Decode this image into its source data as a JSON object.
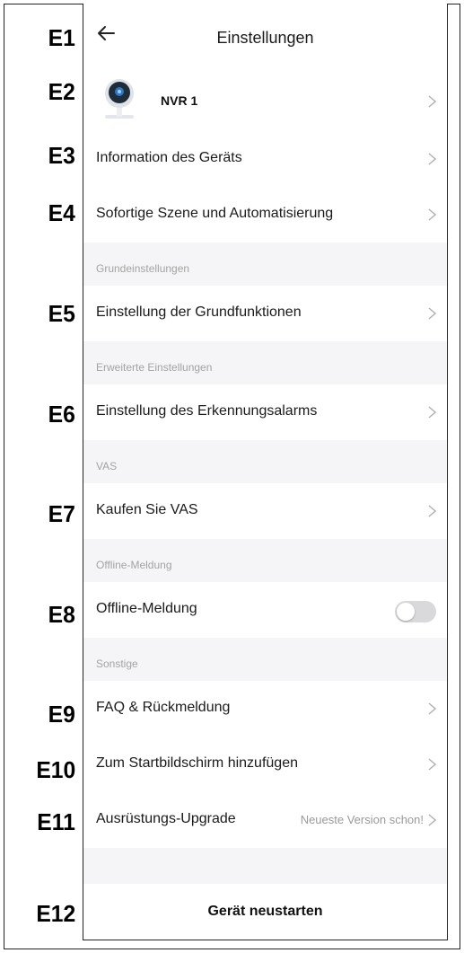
{
  "labels": [
    "E1",
    "E2",
    "E3",
    "E4",
    "E5",
    "E6",
    "E7",
    "E8",
    "E9",
    "E10",
    "E11",
    "E12"
  ],
  "header": {
    "title": "Einstellungen",
    "back_icon": "arrow-left-icon"
  },
  "device": {
    "name": "NVR 1",
    "icon": "camera-icon"
  },
  "rows": {
    "info": "Information des Geräts",
    "scene": "Sofortige Szene und Automatisierung",
    "basic": "Einstellung der Grundfunktionen",
    "alarm": "Einstellung des Erkennungsalarms",
    "vas": "Kaufen Sie VAS",
    "offline": "Offline-Meldung",
    "faq": "FAQ & Rückmeldung",
    "home": "Zum Startbildschirm hinzufügen",
    "upgrade": "Ausrüstungs-Upgrade",
    "upgrade_status": "Neueste Version schon!"
  },
  "sections": {
    "basic": "Grundeinstellungen",
    "advanced": "Erweiterte Einstellungen",
    "vas": "VAS",
    "offline": "Offline-Meldung",
    "other": "Sonstige"
  },
  "offline_toggle": {
    "enabled": false,
    "track_color": "#d9d9dc"
  },
  "footer": {
    "restart": "Gerät neustarten"
  },
  "colors": {
    "page_bg": "#f5f5f7",
    "text": "#1a1a1a",
    "muted": "#a3a3a3"
  }
}
